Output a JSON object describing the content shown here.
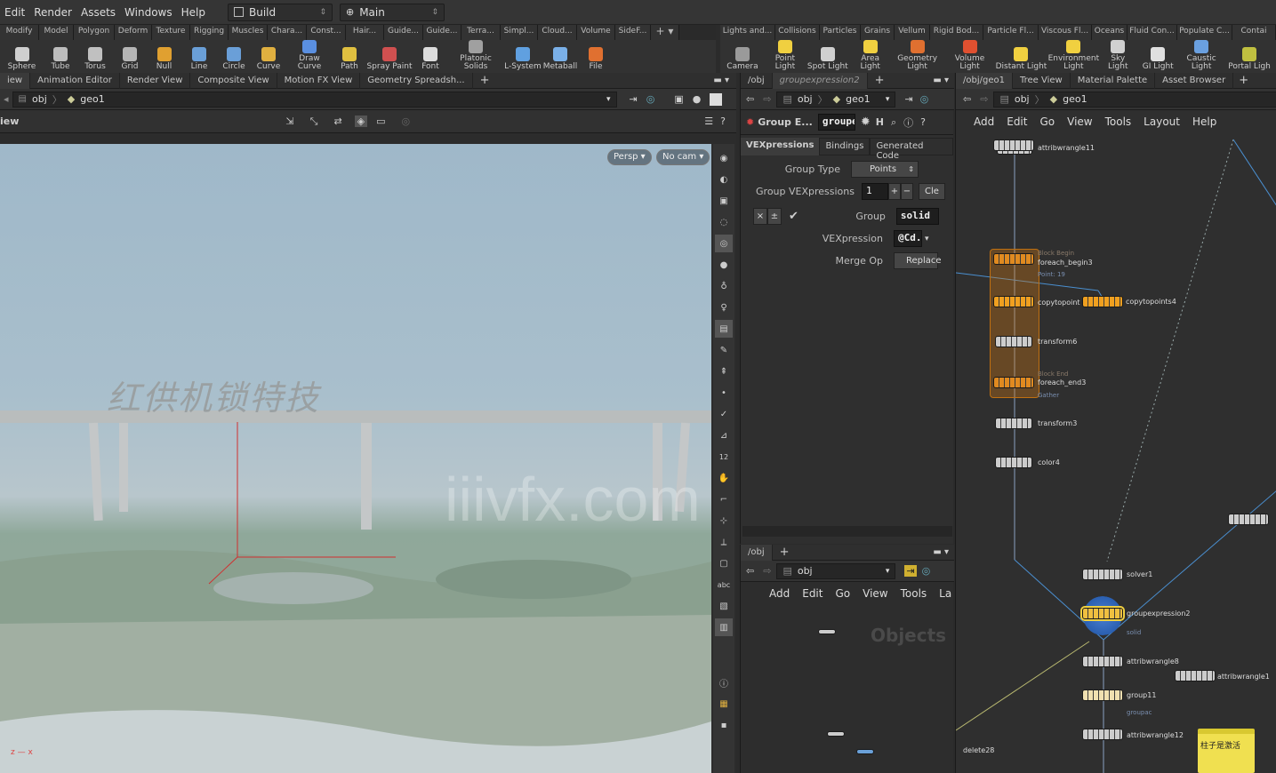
{
  "menubar": {
    "items": [
      "Edit",
      "Render",
      "Assets",
      "Windows",
      "Help"
    ],
    "desktop": "Build",
    "context": "Main"
  },
  "shelf_tabs_left": [
    "Modify",
    "Model",
    "Polygon",
    "Deform",
    "Texture",
    "Rigging",
    "Muscles",
    "Chara...",
    "Const...",
    "Hair...",
    "Guide...",
    "Guide...",
    "Terra...",
    "Simpl...",
    "Cloud...",
    "Volume",
    "SideF..."
  ],
  "shelf_tabs_right": [
    "Lights and...",
    "Collisions",
    "Particles",
    "Grains",
    "Vellum",
    "Rigid Bod...",
    "Particle Fl...",
    "Viscous Fl...",
    "Oceans",
    "Fluid Con...",
    "Populate C...",
    "Contai"
  ],
  "tools_left": [
    {
      "label": "Sphere",
      "icon": "sphere-icon",
      "color": "#cfcfcf"
    },
    {
      "label": "Tube",
      "icon": "tube-icon",
      "color": "#bdbdbd"
    },
    {
      "label": "Torus",
      "icon": "torus-icon",
      "color": "#c0c0c0"
    },
    {
      "label": "Grid",
      "icon": "grid-icon",
      "color": "#b5b5b5"
    },
    {
      "label": "Null",
      "icon": "null-icon",
      "color": "#e0a030"
    },
    {
      "label": "Line",
      "icon": "line-icon",
      "color": "#6a9fd8"
    },
    {
      "label": "Circle",
      "icon": "circle-icon",
      "color": "#6a9fd8"
    },
    {
      "label": "Curve",
      "icon": "curve-icon",
      "color": "#e0b040"
    },
    {
      "label": "Draw Curve",
      "icon": "draw-curve-icon",
      "color": "#5a8fe0"
    },
    {
      "label": "Path",
      "icon": "path-icon",
      "color": "#e0c040"
    },
    {
      "label": "Spray Paint",
      "icon": "spray-paint-icon",
      "color": "#d05050"
    },
    {
      "label": "Font",
      "icon": "font-icon",
      "color": "#dcdcdc"
    },
    {
      "label": "Platonic Solids",
      "icon": "platonic-solids-icon",
      "color": "#a0a0a0"
    },
    {
      "label": "L-System",
      "icon": "lsystem-icon",
      "color": "#60a0e0"
    },
    {
      "label": "Metaball",
      "icon": "metaball-icon",
      "color": "#7ab0e8"
    },
    {
      "label": "File",
      "icon": "file-icon",
      "color": "#e07030"
    }
  ],
  "tools_right": [
    {
      "label": "Camera",
      "icon": "camera-icon",
      "color": "#9a9a9a"
    },
    {
      "label": "Point Light",
      "icon": "point-light-icon",
      "color": "#f0d040"
    },
    {
      "label": "Spot Light",
      "icon": "spot-light-icon",
      "color": "#d0d0d0"
    },
    {
      "label": "Area Light",
      "icon": "area-light-icon",
      "color": "#f0d040"
    },
    {
      "label": "Geometry Light",
      "icon": "geometry-light-icon",
      "color": "#e07030"
    },
    {
      "label": "Volume Light",
      "icon": "volume-light-icon",
      "color": "#e05030"
    },
    {
      "label": "Distant Light",
      "icon": "distant-light-icon",
      "color": "#f0d040"
    },
    {
      "label": "Environment Light",
      "icon": "environment-light-icon",
      "color": "#f0d040"
    },
    {
      "label": "Sky Light",
      "icon": "sky-light-icon",
      "color": "#d0d0d0"
    },
    {
      "label": "GI Light",
      "icon": "gi-light-icon",
      "color": "#e0e0e0"
    },
    {
      "label": "Caustic Light",
      "icon": "caustic-light-icon",
      "color": "#6aa0e0"
    },
    {
      "label": "Portal Ligh",
      "icon": "portal-light-icon",
      "color": "#c0c040"
    }
  ],
  "viewer": {
    "tabs": [
      "iew",
      "Animation Editor",
      "Render View",
      "Composite View",
      "Motion FX View",
      "Geometry Spreadsh..."
    ],
    "path": [
      "obj",
      "geo1"
    ],
    "title": "iew",
    "persp": "Persp ▾",
    "cam": "No cam ▾",
    "watermark": "iiivfx.com",
    "sign_text": "红供机锁特技"
  },
  "params": {
    "tabs": [
      "/obj",
      "groupexpression2"
    ],
    "path": [
      "obj",
      "geo1"
    ],
    "node_type": "Group E...",
    "node_name": "groupe",
    "subtabs": [
      "VEXpressions",
      "Bindings",
      "Generated Code"
    ],
    "group_type_label": "Group Type",
    "group_type": "Points",
    "group_vex_label": "Group VEXpressions",
    "group_vex_count": "1",
    "clear": "Cle",
    "group_label": "Group",
    "group_value": "solid",
    "vex_label": "VEXpression",
    "vex_value": "@Cd.",
    "merge_label": "Merge Op",
    "merge_value": "Replace"
  },
  "obj_net": {
    "tab": "/obj",
    "path": "obj",
    "menu": [
      "Add",
      "Edit",
      "Go",
      "View",
      "Tools",
      "La"
    ],
    "watermark": "Objects"
  },
  "geo_net": {
    "tabs": [
      "/obj/geo1",
      "Tree View",
      "Material Palette",
      "Asset Browser"
    ],
    "path": [
      "obj",
      "geo1"
    ],
    "menu": [
      "Add",
      "Edit",
      "Go",
      "View",
      "Tools",
      "Layout",
      "Help"
    ],
    "nodes": {
      "top": "attribwrangle11",
      "attribwrangle11": "attribwrangle11",
      "foreach_begin_sub": "Block Begin",
      "foreach_begin": "foreach_begin3",
      "foreach_begin_note": "Point: 19",
      "copytopoint": "copytopoint",
      "copytopoints4": "copytopoints4",
      "transform6": "transform6",
      "foreach_end_sub": "Block End",
      "foreach_end": "foreach_end3",
      "foreach_end_note": "Gather",
      "transform3": "transform3",
      "color4": "color4",
      "solver1": "solver1",
      "groupexpression2": "groupexpression2",
      "groupexpression2_note": "solid",
      "attribwrangle8": "attribwrangle8",
      "attribwrangle1": "attribwrangle1",
      "group11": "group11",
      "group11_note": "groupac",
      "attribwrangle12": "attribwrangle12",
      "delete28": "delete28",
      "sticky_note": "柱子是激活"
    }
  }
}
